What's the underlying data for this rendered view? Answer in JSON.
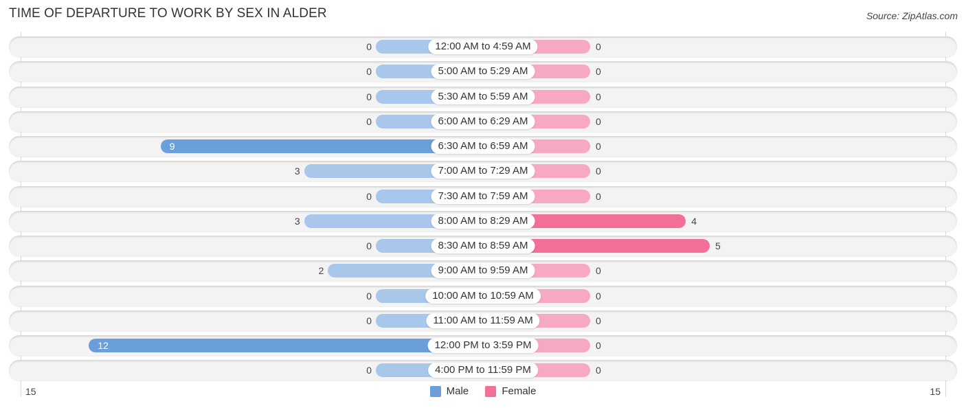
{
  "chart_data": {
    "type": "bar",
    "orientation": "horizontal-butterfly",
    "title": "TIME OF DEPARTURE TO WORK BY SEX IN ALDER",
    "source": "Source: ZipAtlas.com",
    "categories": [
      "12:00 AM to 4:59 AM",
      "5:00 AM to 5:29 AM",
      "5:30 AM to 5:59 AM",
      "6:00 AM to 6:29 AM",
      "6:30 AM to 6:59 AM",
      "7:00 AM to 7:29 AM",
      "7:30 AM to 7:59 AM",
      "8:00 AM to 8:29 AM",
      "8:30 AM to 8:59 AM",
      "9:00 AM to 9:59 AM",
      "10:00 AM to 10:59 AM",
      "11:00 AM to 11:59 AM",
      "12:00 PM to 3:59 PM",
      "4:00 PM to 11:59 PM"
    ],
    "series": [
      {
        "name": "Male",
        "color": "#6a9fdb",
        "values": [
          0,
          0,
          0,
          0,
          9,
          3,
          0,
          3,
          0,
          2,
          0,
          0,
          12,
          0
        ]
      },
      {
        "name": "Female",
        "color": "#f27097",
        "values": [
          0,
          0,
          0,
          0,
          0,
          0,
          0,
          4,
          5,
          0,
          0,
          0,
          0,
          0
        ]
      }
    ],
    "axis": {
      "left_tick": "15",
      "right_tick": "15",
      "range": [
        0,
        15
      ]
    },
    "legend": {
      "position": "bottom-center",
      "items": [
        "Male",
        "Female"
      ]
    }
  }
}
